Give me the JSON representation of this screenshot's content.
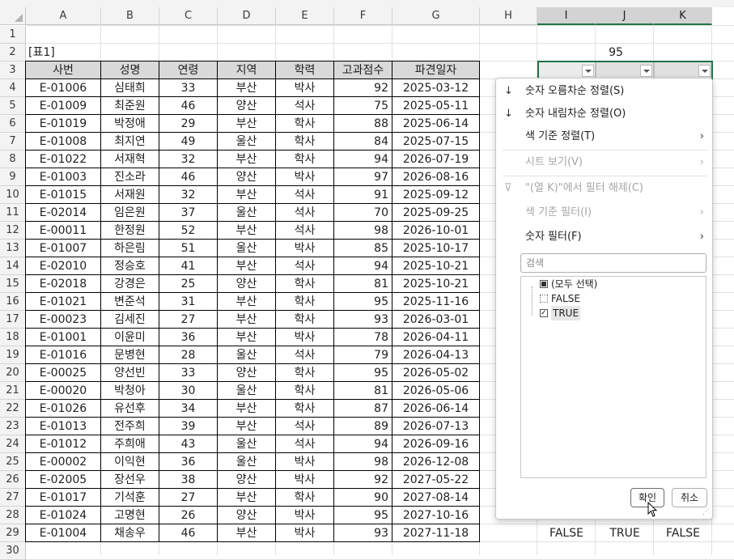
{
  "columns": [
    "A",
    "B",
    "C",
    "D",
    "E",
    "F",
    "G",
    "H",
    "I",
    "J",
    "K"
  ],
  "selected_columns": [
    "I",
    "J",
    "K"
  ],
  "rows": [
    "1",
    "2",
    "3",
    "4",
    "5",
    "6",
    "7",
    "8",
    "9",
    "10",
    "11",
    "12",
    "13",
    "14",
    "15",
    "16",
    "17",
    "18",
    "19",
    "20",
    "21",
    "22",
    "23",
    "24",
    "25",
    "26",
    "27",
    "28",
    "29",
    "30"
  ],
  "sheet": {
    "table_label": "[표1]",
    "criteria_value": "95",
    "headers": [
      "사번",
      "성명",
      "연령",
      "지역",
      "학력",
      "고과점수",
      "파견일자"
    ],
    "data": [
      [
        "E-01006",
        "심태희",
        "33",
        "부산",
        "박사",
        "92",
        "2025-03-12"
      ],
      [
        "E-01009",
        "최준원",
        "46",
        "양산",
        "석사",
        "75",
        "2025-05-11"
      ],
      [
        "E-01019",
        "박정애",
        "29",
        "부산",
        "학사",
        "88",
        "2025-06-14"
      ],
      [
        "E-01008",
        "최지연",
        "49",
        "울산",
        "학사",
        "84",
        "2025-07-15"
      ],
      [
        "E-01022",
        "서재혁",
        "32",
        "부산",
        "학사",
        "94",
        "2026-07-19"
      ],
      [
        "E-01003",
        "진소라",
        "46",
        "양산",
        "박사",
        "97",
        "2026-08-16"
      ],
      [
        "E-01015",
        "서재원",
        "32",
        "부산",
        "석사",
        "91",
        "2025-09-12"
      ],
      [
        "E-02014",
        "임은원",
        "37",
        "울산",
        "석사",
        "70",
        "2025-09-25"
      ],
      [
        "E-00011",
        "한정원",
        "52",
        "부산",
        "석사",
        "98",
        "2026-10-01"
      ],
      [
        "E-01007",
        "하은림",
        "51",
        "울산",
        "박사",
        "85",
        "2025-10-17"
      ],
      [
        "E-02010",
        "정승호",
        "41",
        "부산",
        "석사",
        "94",
        "2025-10-21"
      ],
      [
        "E-02018",
        "강경은",
        "25",
        "양산",
        "학사",
        "81",
        "2025-10-21"
      ],
      [
        "E-01021",
        "변준석",
        "31",
        "부산",
        "학사",
        "95",
        "2025-11-16"
      ],
      [
        "E-00023",
        "김세진",
        "27",
        "부산",
        "학사",
        "93",
        "2026-03-01"
      ],
      [
        "E-01001",
        "이윤미",
        "36",
        "부산",
        "박사",
        "78",
        "2026-04-11"
      ],
      [
        "E-01016",
        "문병현",
        "28",
        "울산",
        "석사",
        "79",
        "2026-04-13"
      ],
      [
        "E-00025",
        "양선빈",
        "33",
        "양산",
        "학사",
        "95",
        "2026-05-02"
      ],
      [
        "E-00020",
        "박청아",
        "30",
        "울산",
        "학사",
        "81",
        "2026-05-06"
      ],
      [
        "E-01026",
        "유선후",
        "34",
        "부산",
        "학사",
        "87",
        "2026-06-14"
      ],
      [
        "E-01013",
        "전주희",
        "39",
        "부산",
        "석사",
        "89",
        "2026-07-13"
      ],
      [
        "E-01012",
        "주희애",
        "43",
        "울산",
        "석사",
        "94",
        "2026-09-16"
      ],
      [
        "E-00002",
        "이익현",
        "36",
        "울산",
        "박사",
        "98",
        "2026-12-08"
      ],
      [
        "E-02005",
        "장선우",
        "38",
        "양산",
        "박사",
        "92",
        "2027-05-22"
      ],
      [
        "E-01017",
        "기석훈",
        "27",
        "부산",
        "학사",
        "90",
        "2027-08-14"
      ],
      [
        "E-01024",
        "고명현",
        "26",
        "양산",
        "박사",
        "95",
        "2027-10-16"
      ],
      [
        "E-01004",
        "채송우",
        "46",
        "부산",
        "박사",
        "93",
        "2027-11-18"
      ]
    ],
    "row29_criteria": [
      "FALSE",
      "TRUE",
      "FALSE"
    ]
  },
  "filter_menu": {
    "sort_asc": "숫자 오름차순 정렬(S)",
    "sort_desc": "숫자 내림차순 정렬(O)",
    "sort_by_color": "색 기준 정렬(T)",
    "sheet_view": "시트 보기(V)",
    "clear_filter": "\"(열 K)\"에서 필터 해제(C)",
    "filter_by_color": "색 기준 필터(I)",
    "number_filters": "숫자 필터(F)",
    "search_placeholder": "검색",
    "list_items": [
      "(모두 선택)",
      "FALSE",
      "TRUE"
    ],
    "ok": "확인",
    "cancel": "취소"
  },
  "colors": {
    "selection_green": "#217346",
    "header_fill": "#d9d9d9"
  }
}
